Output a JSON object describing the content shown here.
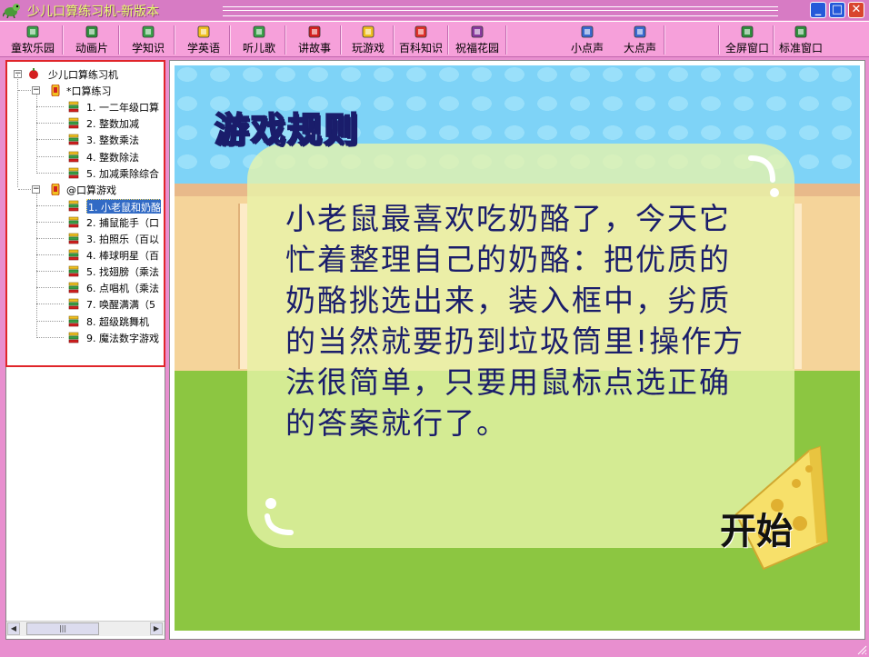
{
  "window": {
    "title": "少儿口算练习机-新版本",
    "buttons": {
      "minimize": "_",
      "maximize": "□",
      "close": "✕"
    }
  },
  "toolbar": {
    "items": [
      {
        "label": "童软乐园",
        "icon": "home-icon",
        "color": "#3aa04a"
      },
      {
        "label": "动画片",
        "icon": "film-icon",
        "color": "#2f8e3d"
      },
      {
        "label": "学知识",
        "icon": "book-icon",
        "color": "#3aa04a"
      },
      {
        "label": "学英语",
        "icon": "abc-icon",
        "color": "#f0c020"
      },
      {
        "label": "听儿歌",
        "icon": "song-icon",
        "color": "#3aa04a"
      },
      {
        "label": "讲故事",
        "icon": "story-icon",
        "color": "#d42020"
      },
      {
        "label": "玩游戏",
        "icon": "game-icon",
        "color": "#f0c020"
      },
      {
        "label": "百科知识",
        "icon": "encyclopedia-icon",
        "color": "#e0302a"
      },
      {
        "label": "祝福花园",
        "icon": "garden-icon",
        "color": "#8a3aa0"
      },
      {
        "label": "小点声",
        "icon": "volume-down-icon",
        "color": "#3a6ad0"
      },
      {
        "label": "大点声",
        "icon": "volume-up-icon",
        "color": "#3a6ad0"
      },
      {
        "label": "全屏窗口",
        "icon": "fullscreen-icon",
        "color": "#2f8e3d"
      },
      {
        "label": "标准窗口",
        "icon": "window-icon",
        "color": "#2f8e3d"
      }
    ]
  },
  "tree": {
    "root": "少儿口算练习机",
    "groups": [
      {
        "label": "*口算练习",
        "items": [
          "1. 一二年级口算",
          "2. 整数加减",
          "3. 整数乘法",
          "4. 整数除法",
          "5. 加减乘除综合"
        ]
      },
      {
        "label": "@口算游戏",
        "items": [
          "1. 小老鼠和奶酪",
          "2. 捕鼠能手（口",
          "3. 拍照乐（百以",
          "4. 棒球明星（百",
          "5. 找翅膀（乘法",
          "6. 点唱机（乘法",
          "7. 唤醒满满（5",
          "8. 超级跳舞机",
          "9. 魔法数字游戏"
        ]
      }
    ],
    "selected": "1. 小老鼠和奶酪",
    "scroll_thumb": "|||"
  },
  "game": {
    "title": "游戏规则",
    "text": "小老鼠最喜欢吃奶酪了，今天它忙着整理自己的奶酪：把优质的奶酪挑选出来，装入框中，劣质的当然就要扔到垃圾筒里!操作方法很简单，只要用鼠标点选正确的答案就行了。",
    "start": "开始"
  },
  "colors": {
    "titlebar": "#d77bc4",
    "toolbar": "#f6a0da",
    "sky": "#7ed3f7",
    "grass": "#8cc641",
    "rule_text": "#1a1d6b",
    "selection": "#316ac5",
    "highlight_border": "#e0252a"
  }
}
